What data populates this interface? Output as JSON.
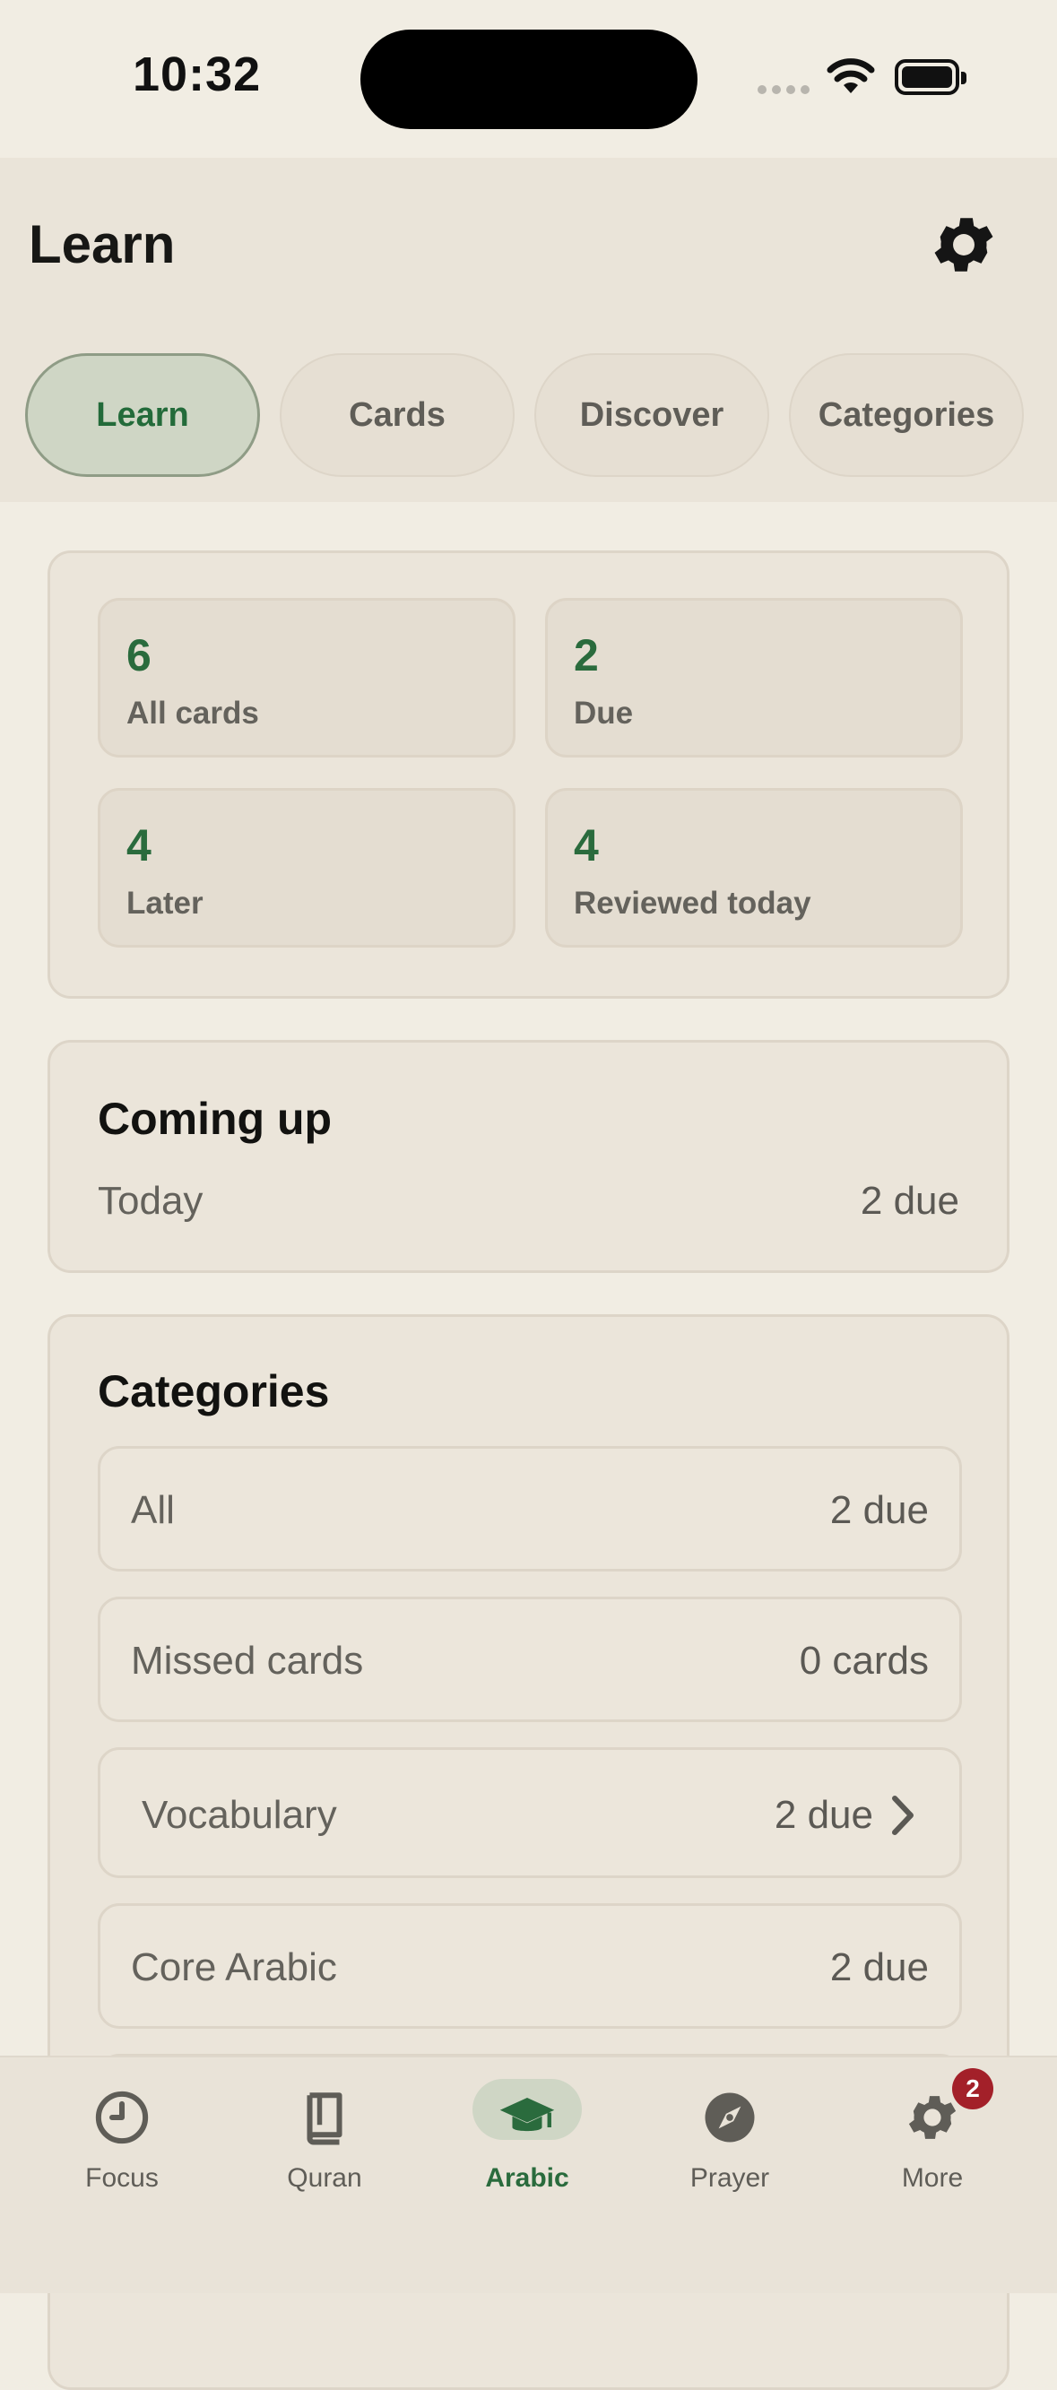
{
  "status_bar": {
    "time": "10:32"
  },
  "header": {
    "title": "Learn"
  },
  "tabs": [
    {
      "label": "Learn",
      "active": true
    },
    {
      "label": "Cards",
      "active": false
    },
    {
      "label": "Discover",
      "active": false
    },
    {
      "label": "Categories",
      "active": false
    }
  ],
  "stats": [
    {
      "value": "6",
      "label": "All cards"
    },
    {
      "value": "2",
      "label": "Due"
    },
    {
      "value": "4",
      "label": "Later"
    },
    {
      "value": "4",
      "label": "Reviewed today"
    }
  ],
  "coming_up": {
    "title": "Coming up",
    "rows": [
      {
        "label": "Today",
        "value": "2 due"
      }
    ]
  },
  "categories": {
    "title": "Categories",
    "items": [
      {
        "label": "All",
        "value": "2 due"
      },
      {
        "label": "Missed cards",
        "value": "0 cards"
      },
      {
        "label": "Vocabulary",
        "value": "2 due",
        "chevron": true
      },
      {
        "label": "Core Arabic",
        "value": "2 due"
      }
    ]
  },
  "bottom_nav": {
    "items": [
      {
        "label": "Focus",
        "icon": "clock-icon"
      },
      {
        "label": "Quran",
        "icon": "book-icon"
      },
      {
        "label": "Arabic",
        "icon": "graduation-cap-icon",
        "active": true
      },
      {
        "label": "Prayer",
        "icon": "compass-icon"
      },
      {
        "label": "More",
        "icon": "gear-icon",
        "badge": "2"
      }
    ]
  },
  "colors": {
    "accent_green": "#2a6b3d",
    "active_tab_bg": "#cfd6c5",
    "badge_red": "#a32029",
    "background": "#f1ede3"
  }
}
